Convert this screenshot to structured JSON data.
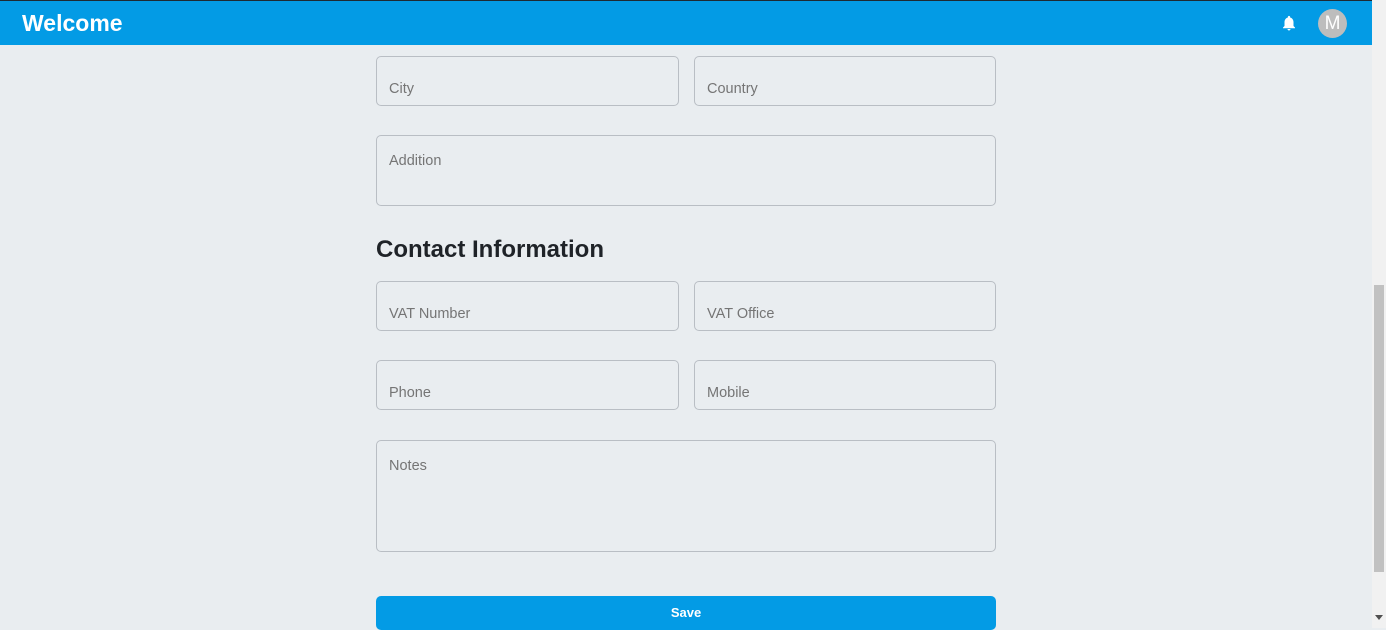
{
  "header": {
    "title": "Welcome",
    "notifications_icon": "bell-icon",
    "avatar_initial": "M"
  },
  "form": {
    "city": {
      "placeholder": "City"
    },
    "country": {
      "placeholder": "Country"
    },
    "addition": {
      "placeholder": "Addition"
    },
    "contact_section_title": "Contact Information",
    "vat_number": {
      "placeholder": "VAT Number"
    },
    "vat_office": {
      "placeholder": "VAT Office"
    },
    "phone": {
      "placeholder": "Phone"
    },
    "mobile": {
      "placeholder": "Mobile"
    },
    "notes": {
      "placeholder": "Notes"
    },
    "save_label": "Save"
  },
  "colors": {
    "accent": "#039be5",
    "background": "#e9edf0"
  }
}
